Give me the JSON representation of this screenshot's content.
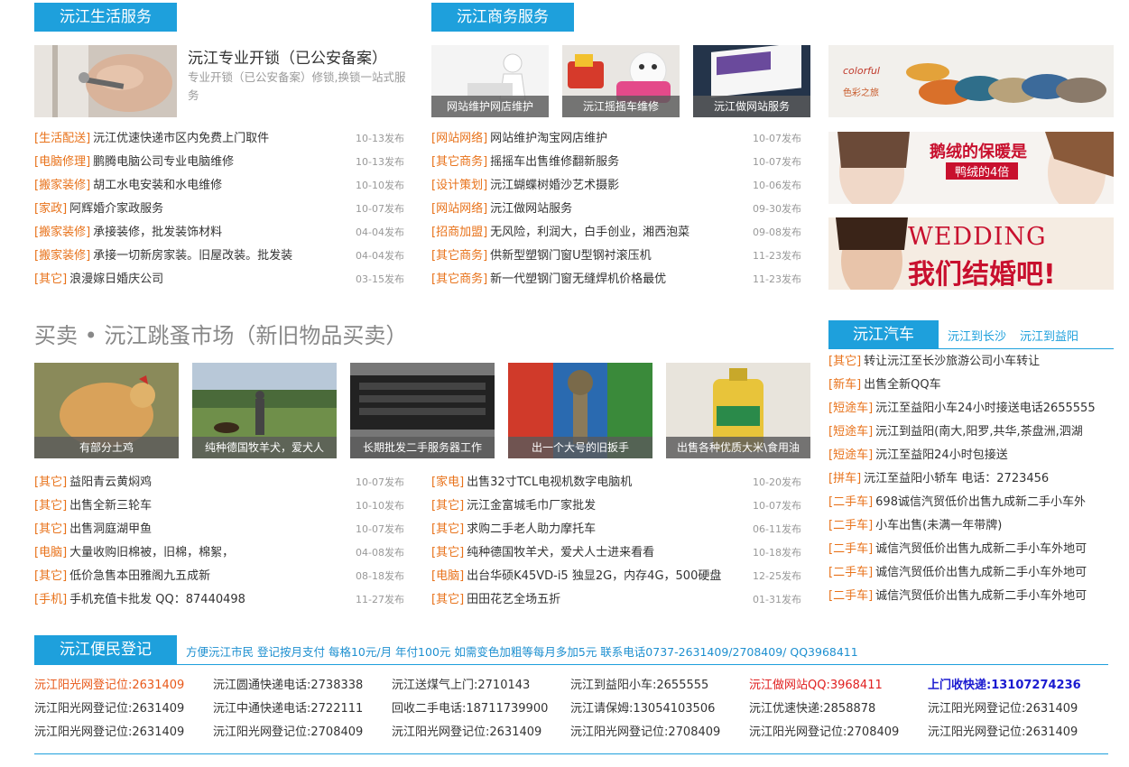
{
  "life": {
    "title": "沅江生活服务",
    "feature": {
      "title": "沅江专业开锁（已公安备案）",
      "desc": "专业开锁（已公安备案）修锁,换锁一站式服务"
    },
    "items": [
      {
        "cat": "[生活配送]",
        "text": "沅江优速快递市区内免费上门取件",
        "date": "10-13发布"
      },
      {
        "cat": "[电脑修理]",
        "text": "鹏腾电脑公司专业电脑维修",
        "date": "10-13发布"
      },
      {
        "cat": "[搬家装修]",
        "text": "胡工水电安装和水电维修",
        "date": "10-10发布"
      },
      {
        "cat": "[家政]",
        "text": "阿辉婚介家政服务",
        "date": "10-07发布"
      },
      {
        "cat": "[搬家装修]",
        "text": "承接装修，批发装饰材料",
        "date": "04-04发布"
      },
      {
        "cat": "[搬家装修]",
        "text": "承接一切新房家装。旧屋改装。批发装",
        "date": "04-04发布"
      },
      {
        "cat": "[其它]",
        "text": "浪漫嫁日婚庆公司",
        "date": "03-15发布"
      }
    ]
  },
  "business": {
    "title": "沅江商务服务",
    "thumbs": [
      {
        "caption": "网站维护网店维护"
      },
      {
        "caption": "沅江摇摇车维修"
      },
      {
        "caption": "沅江做网站服务"
      }
    ],
    "items": [
      {
        "cat": "[网站网络]",
        "text": "网站维护淘宝网店维护",
        "date": "10-07发布"
      },
      {
        "cat": "[其它商务]",
        "text": "摇摇车出售维修翻新服务",
        "date": "10-07发布"
      },
      {
        "cat": "[设计策划]",
        "text": "沅江蝴蝶树婚沙艺术摄影",
        "date": "10-06发布"
      },
      {
        "cat": "[网站网络]",
        "text": "沅江做网站服务",
        "date": "09-30发布"
      },
      {
        "cat": "[招商加盟]",
        "text": "无风险，利润大，白手创业，湘西泡菜",
        "date": "09-08发布"
      },
      {
        "cat": "[其它商务]",
        "text": "供新型塑钢门窗U型钢衬滚压机",
        "date": "11-23发布"
      },
      {
        "cat": "[其它商务]",
        "text": "新一代塑钢门窗无缝焊机价格最优",
        "date": "11-23发布"
      }
    ]
  },
  "ads": [
    {
      "line1": "colorful",
      "line2": "色彩之旅"
    },
    {
      "line1": "鹅绒的保暖是",
      "line2": "鸭绒的4倍"
    },
    {
      "line1": "WEDDING",
      "line2": "我们结婚吧!"
    }
  ],
  "market": {
    "title": "买卖 • 沅江跳蚤市场（新旧物品买卖）",
    "thumbs": [
      {
        "caption": "有部分土鸡"
      },
      {
        "caption": "纯种德国牧羊犬，爱犬人"
      },
      {
        "caption": "长期批发二手服务器工作"
      },
      {
        "caption": "出一个大号的旧扳手"
      },
      {
        "caption": "出售各种优质大米\\食用油"
      }
    ],
    "left": [
      {
        "cat": "[其它]",
        "text": "益阳青云黄焖鸡",
        "date": "10-07发布"
      },
      {
        "cat": "[其它]",
        "text": "出售全新三轮车",
        "date": "10-10发布"
      },
      {
        "cat": "[其它]",
        "text": "出售洞庭湖甲鱼",
        "date": "10-07发布"
      },
      {
        "cat": "[电脑]",
        "text": "大量收购旧棉被，旧棉，棉絮，",
        "date": "04-08发布"
      },
      {
        "cat": "[其它]",
        "text": "低价急售本田雅阁九五成新",
        "date": "08-18发布"
      },
      {
        "cat": "[手机]",
        "text": "手机充值卡批发 QQ：87440498",
        "date": "11-27发布"
      }
    ],
    "right": [
      {
        "cat": "[家电]",
        "text": "出售32寸TCL电视机数字电脑机",
        "date": "10-20发布"
      },
      {
        "cat": "[其它]",
        "text": "沅江金富城毛巾厂家批发",
        "date": "10-07发布"
      },
      {
        "cat": "[其它]",
        "text": "求购二手老人助力摩托车",
        "date": "06-11发布"
      },
      {
        "cat": "[其它]",
        "text": "纯种德国牧羊犬，爱犬人士进来看看",
        "date": "10-18发布"
      },
      {
        "cat": "[电脑]",
        "text": "出台华硕K45VD-i5 独显2G，内存4G，500硬盘",
        "date": "12-25发布"
      },
      {
        "cat": "[其它]",
        "text": "田田花艺全场五折",
        "date": "01-31发布"
      }
    ]
  },
  "car": {
    "title": "沅江汽车",
    "links": [
      "沅江到长沙",
      "沅江到益阳"
    ],
    "items": [
      {
        "cat": "[其它]",
        "text": "转让沅江至长沙旅游公司小车转让"
      },
      {
        "cat": "[新车]",
        "text": "出售全新QQ车"
      },
      {
        "cat": "[短途车]",
        "text": "沅江至益阳小车24小时接送电话2655555"
      },
      {
        "cat": "[短途车]",
        "text": "沅江到益阳(南大,阳罗,共华,茶盘洲,泗湖"
      },
      {
        "cat": "[短途车]",
        "text": "沅江至益阳24小时包接送"
      },
      {
        "cat": "[拼车]",
        "text": "沅江至益阳小轿车 电话：2723456"
      },
      {
        "cat": "[二手车]",
        "text": "698诚信汽贸低价出售九成新二手小车外"
      },
      {
        "cat": "[二手车]",
        "text": "小车出售(未满一年带牌)"
      },
      {
        "cat": "[二手车]",
        "text": "诚信汽贸低价出售九成新二手小车外地可"
      },
      {
        "cat": "[二手车]",
        "text": "诚信汽贸低价出售九成新二手小车外地可"
      },
      {
        "cat": "[二手车]",
        "text": "诚信汽贸低价出售九成新二手小车外地可"
      }
    ]
  },
  "register": {
    "title": "沅江便民登记",
    "note": "方便沅江市民 登记按月支付 每格10元/月 年付100元 如需变色加粗等每月多加5元 联系电话0737-2631409/2708409/ QQ3968411",
    "rows": [
      [
        "沅江阳光网登记位:2631409",
        "沅江圆通快递电话:2738338",
        "沅江送煤气上门:2710143",
        "沅江到益阳小车:2655555",
        "沅江做网站QQ:3968411",
        "上门收快递:13107274236"
      ],
      [
        "沅江阳光网登记位:2631409",
        "沅江中通快递电话:2722111",
        "回收二手电话:18711739900",
        "沅江请保姆:13054103506",
        "沅江优速快递:2858878",
        "沅江阳光网登记位:2631409"
      ],
      [
        "沅江阳光网登记位:2631409",
        "沅江阳光网登记位:2708409",
        "沅江阳光网登记位:2631409",
        "沅江阳光网登记位:2708409",
        "沅江阳光网登记位:2708409",
        "沅江阳光网登记位:2631409"
      ]
    ],
    "colors": {
      "orange": "#e8591a",
      "red": "#e02020",
      "blue": "#1a1ad0"
    }
  },
  "colors": {
    "accent": "#1ea0dc",
    "category": "#e8721a",
    "date": "#999999"
  }
}
